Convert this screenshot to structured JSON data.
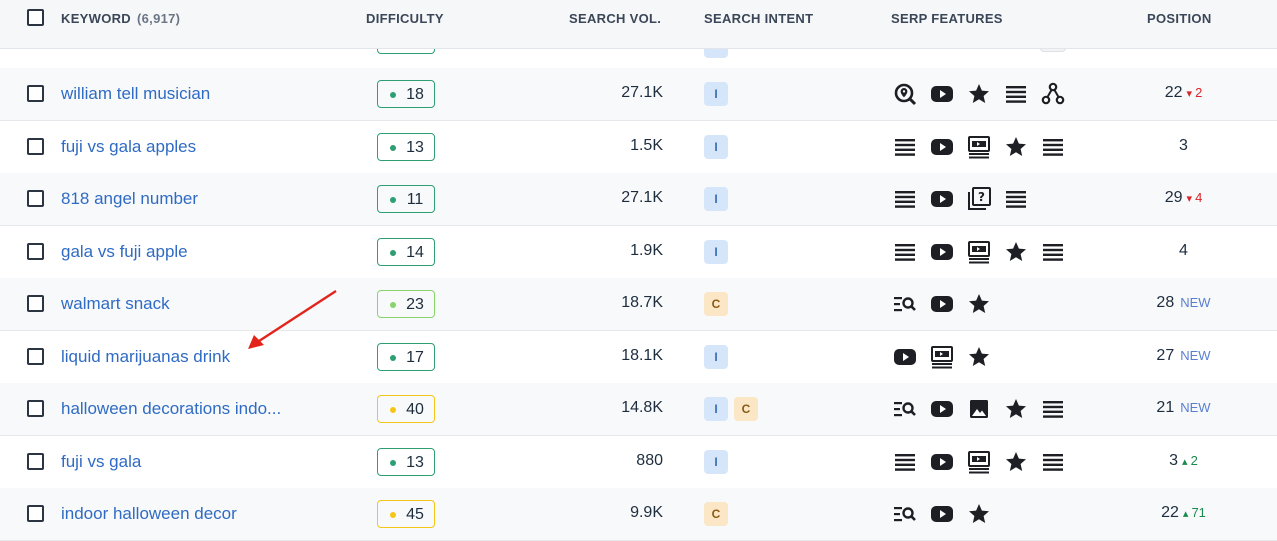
{
  "header": {
    "keyword_label": "KEYWORD",
    "keyword_count": "(6,917)",
    "difficulty_label": "DIFFICULTY",
    "volume_label": "SEARCH VOL.",
    "intent_label": "SEARCH INTENT",
    "serp_label": "SERP FEATURES",
    "position_label": "POSITION"
  },
  "rows": [
    {
      "keyword": "william tell musician",
      "difficulty": "18",
      "diff_level": "green",
      "volume": "27.1K",
      "intents": [
        "I"
      ],
      "serp": [
        "local-search-icon",
        "video-icon",
        "star-icon",
        "list-icon",
        "knowledge-graph-icon"
      ],
      "position": "22",
      "change": "2",
      "change_dir": "down"
    },
    {
      "keyword": "fuji vs gala apples",
      "difficulty": "13",
      "diff_level": "green",
      "volume": "1.5K",
      "intents": [
        "I"
      ],
      "serp": [
        "list-icon",
        "video-icon",
        "video-carousel-icon",
        "star-icon",
        "list-icon"
      ],
      "position": "3",
      "change": "",
      "change_dir": ""
    },
    {
      "keyword": "818 angel number",
      "difficulty": "11",
      "diff_level": "green",
      "volume": "27.1K",
      "intents": [
        "I"
      ],
      "serp": [
        "list-icon",
        "video-icon",
        "faq-icon",
        "list-icon"
      ],
      "position": "29",
      "change": "4",
      "change_dir": "down"
    },
    {
      "keyword": "gala vs fuji apple",
      "difficulty": "14",
      "diff_level": "green",
      "volume": "1.9K",
      "intents": [
        "I"
      ],
      "serp": [
        "list-icon",
        "video-icon",
        "video-carousel-icon",
        "star-icon",
        "list-icon"
      ],
      "position": "4",
      "change": "",
      "change_dir": ""
    },
    {
      "keyword": "walmart snack",
      "difficulty": "23",
      "diff_level": "lightgreen",
      "volume": "18.7K",
      "intents": [
        "C"
      ],
      "serp": [
        "related-search-icon",
        "video-icon",
        "star-icon"
      ],
      "position": "28",
      "change": "NEW",
      "change_dir": "new"
    },
    {
      "keyword": "liquid marijuanas drink",
      "difficulty": "17",
      "diff_level": "green",
      "volume": "18.1K",
      "intents": [
        "I"
      ],
      "serp": [
        "video-icon",
        "video-carousel-icon",
        "star-icon"
      ],
      "position": "27",
      "change": "NEW",
      "change_dir": "new"
    },
    {
      "keyword": "halloween decorations indo...",
      "difficulty": "40",
      "diff_level": "yellow",
      "volume": "14.8K",
      "intents": [
        "I",
        "C"
      ],
      "serp": [
        "related-search-icon",
        "video-icon",
        "image-icon",
        "star-icon",
        "list-icon"
      ],
      "position": "21",
      "change": "NEW",
      "change_dir": "new"
    },
    {
      "keyword": "fuji vs gala",
      "difficulty": "13",
      "diff_level": "green",
      "volume": "880",
      "intents": [
        "I"
      ],
      "serp": [
        "list-icon",
        "video-icon",
        "video-carousel-icon",
        "star-icon",
        "list-icon"
      ],
      "position": "3",
      "change": "2",
      "change_dir": "up"
    },
    {
      "keyword": "indoor halloween decor",
      "difficulty": "45",
      "diff_level": "yellow",
      "volume": "9.9K",
      "intents": [
        "C"
      ],
      "serp": [
        "related-search-icon",
        "video-icon",
        "star-icon"
      ],
      "position": "22",
      "change": "71",
      "change_dir": "up"
    }
  ],
  "colors": {
    "link": "#2f6bc4",
    "green": "#2e9e73",
    "lightgreen": "#88d46b",
    "yellow": "#f5c518",
    "annotation_arrow": "#e3241b"
  }
}
